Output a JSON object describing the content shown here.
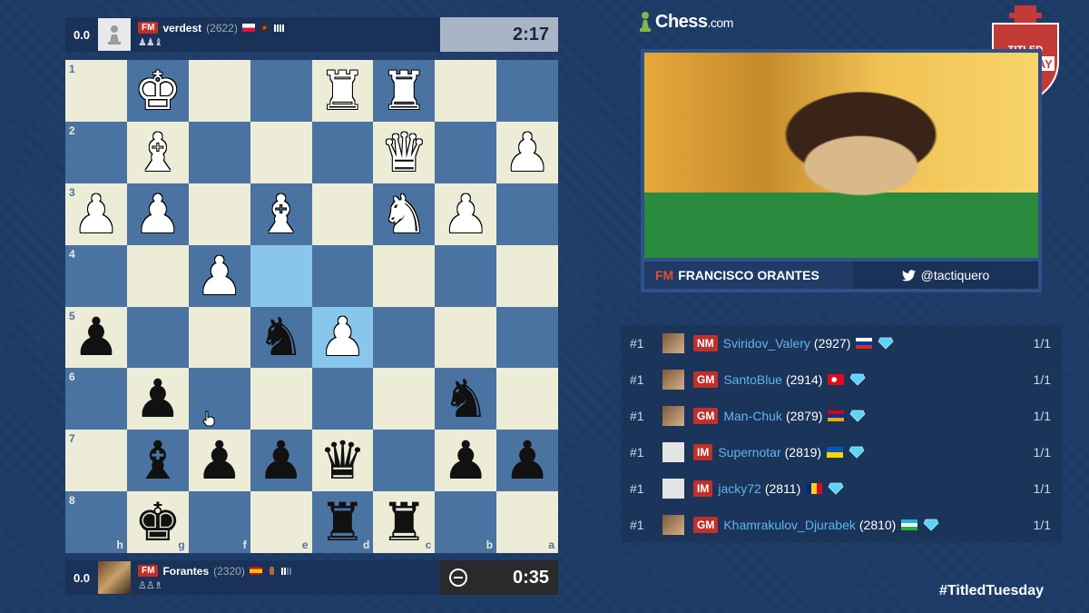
{
  "top_player": {
    "score": "0.0",
    "title": "FM",
    "name": "verdest",
    "rating": "(2622)",
    "clock": "2:17"
  },
  "bottom_player": {
    "score": "0.0",
    "title": "FM",
    "name": "Forantes",
    "rating": "(2320)",
    "clock": "0:35"
  },
  "board": {
    "ranks": [
      "1",
      "2",
      "3",
      "4",
      "5",
      "6",
      "7",
      "8"
    ],
    "files": [
      "h",
      "g",
      "f",
      "e",
      "d",
      "c",
      "b",
      "a"
    ],
    "highlighted": [
      "4-3",
      "5-4"
    ],
    "pieces": {
      "1-1": [
        "w",
        "♚"
      ],
      "1-4": [
        "w",
        "♜"
      ],
      "1-5": [
        "w",
        "♜"
      ],
      "2-1": [
        "w",
        "♝"
      ],
      "2-5": [
        "w",
        "♛"
      ],
      "2-7": [
        "w",
        "♟"
      ],
      "3-0": [
        "w",
        "♟"
      ],
      "3-1": [
        "w",
        "♟"
      ],
      "3-3": [
        "w",
        "♝"
      ],
      "3-5": [
        "w",
        "♞"
      ],
      "3-6": [
        "w",
        "♟"
      ],
      "4-2": [
        "w",
        "♟"
      ],
      "5-0": [
        "b",
        "♟"
      ],
      "5-3": [
        "b",
        "♞"
      ],
      "5-4": [
        "w",
        "♟"
      ],
      "6-1": [
        "b",
        "♟"
      ],
      "6-6": [
        "b",
        "♞"
      ],
      "7-1": [
        "b",
        "♝"
      ],
      "7-2": [
        "b",
        "♟"
      ],
      "7-3": [
        "b",
        "♟"
      ],
      "7-4": [
        "b",
        "♛"
      ],
      "7-6": [
        "b",
        "♟"
      ],
      "7-7": [
        "b",
        "♟"
      ],
      "8-1": [
        "b",
        "♚"
      ],
      "8-4": [
        "b",
        "♜"
      ],
      "8-5": [
        "b",
        "♜"
      ]
    }
  },
  "brand": {
    "name": "Chess",
    "suffix": ".com"
  },
  "event_badge": {
    "line1": "TITLED",
    "line2": "TUE$DAY"
  },
  "streamer": {
    "title": "FM",
    "name": "FRANCISCO ORANTES",
    "twitter": "@tactiquero"
  },
  "leaderboard": [
    {
      "rank": "#1",
      "title": "NM",
      "name": "Sviridov_Valery",
      "rating": "(2927)",
      "flag": "ru",
      "score": "1/1",
      "avatar": "photo"
    },
    {
      "rank": "#1",
      "title": "GM",
      "name": "SantoBlue",
      "rating": "(2914)",
      "flag": "tr",
      "score": "1/1",
      "avatar": "photo"
    },
    {
      "rank": "#1",
      "title": "GM",
      "name": "Man-Chuk",
      "rating": "(2879)",
      "flag": "am",
      "score": "1/1",
      "avatar": "photo"
    },
    {
      "rank": "#1",
      "title": "IM",
      "name": "Supernotar",
      "rating": "(2819)",
      "flag": "ua",
      "score": "1/1",
      "avatar": "gray"
    },
    {
      "rank": "#1",
      "title": "IM",
      "name": "jacky72",
      "rating": "(2811)",
      "flag": "ro",
      "score": "1/1",
      "avatar": "gray"
    },
    {
      "rank": "#1",
      "title": "GM",
      "name": "Khamrakulov_Djurabek",
      "rating": "(2810)",
      "flag": "uz",
      "score": "1/1",
      "avatar": "photo"
    }
  ],
  "hashtag": "#TitledTuesday",
  "colors": {
    "background": "#1c3a66",
    "board_light": "#ececd7",
    "board_dark": "#4a73a2",
    "highlight": "#88c6ec",
    "title_badge": "#c0302a",
    "link_name": "#5fb4f0"
  }
}
